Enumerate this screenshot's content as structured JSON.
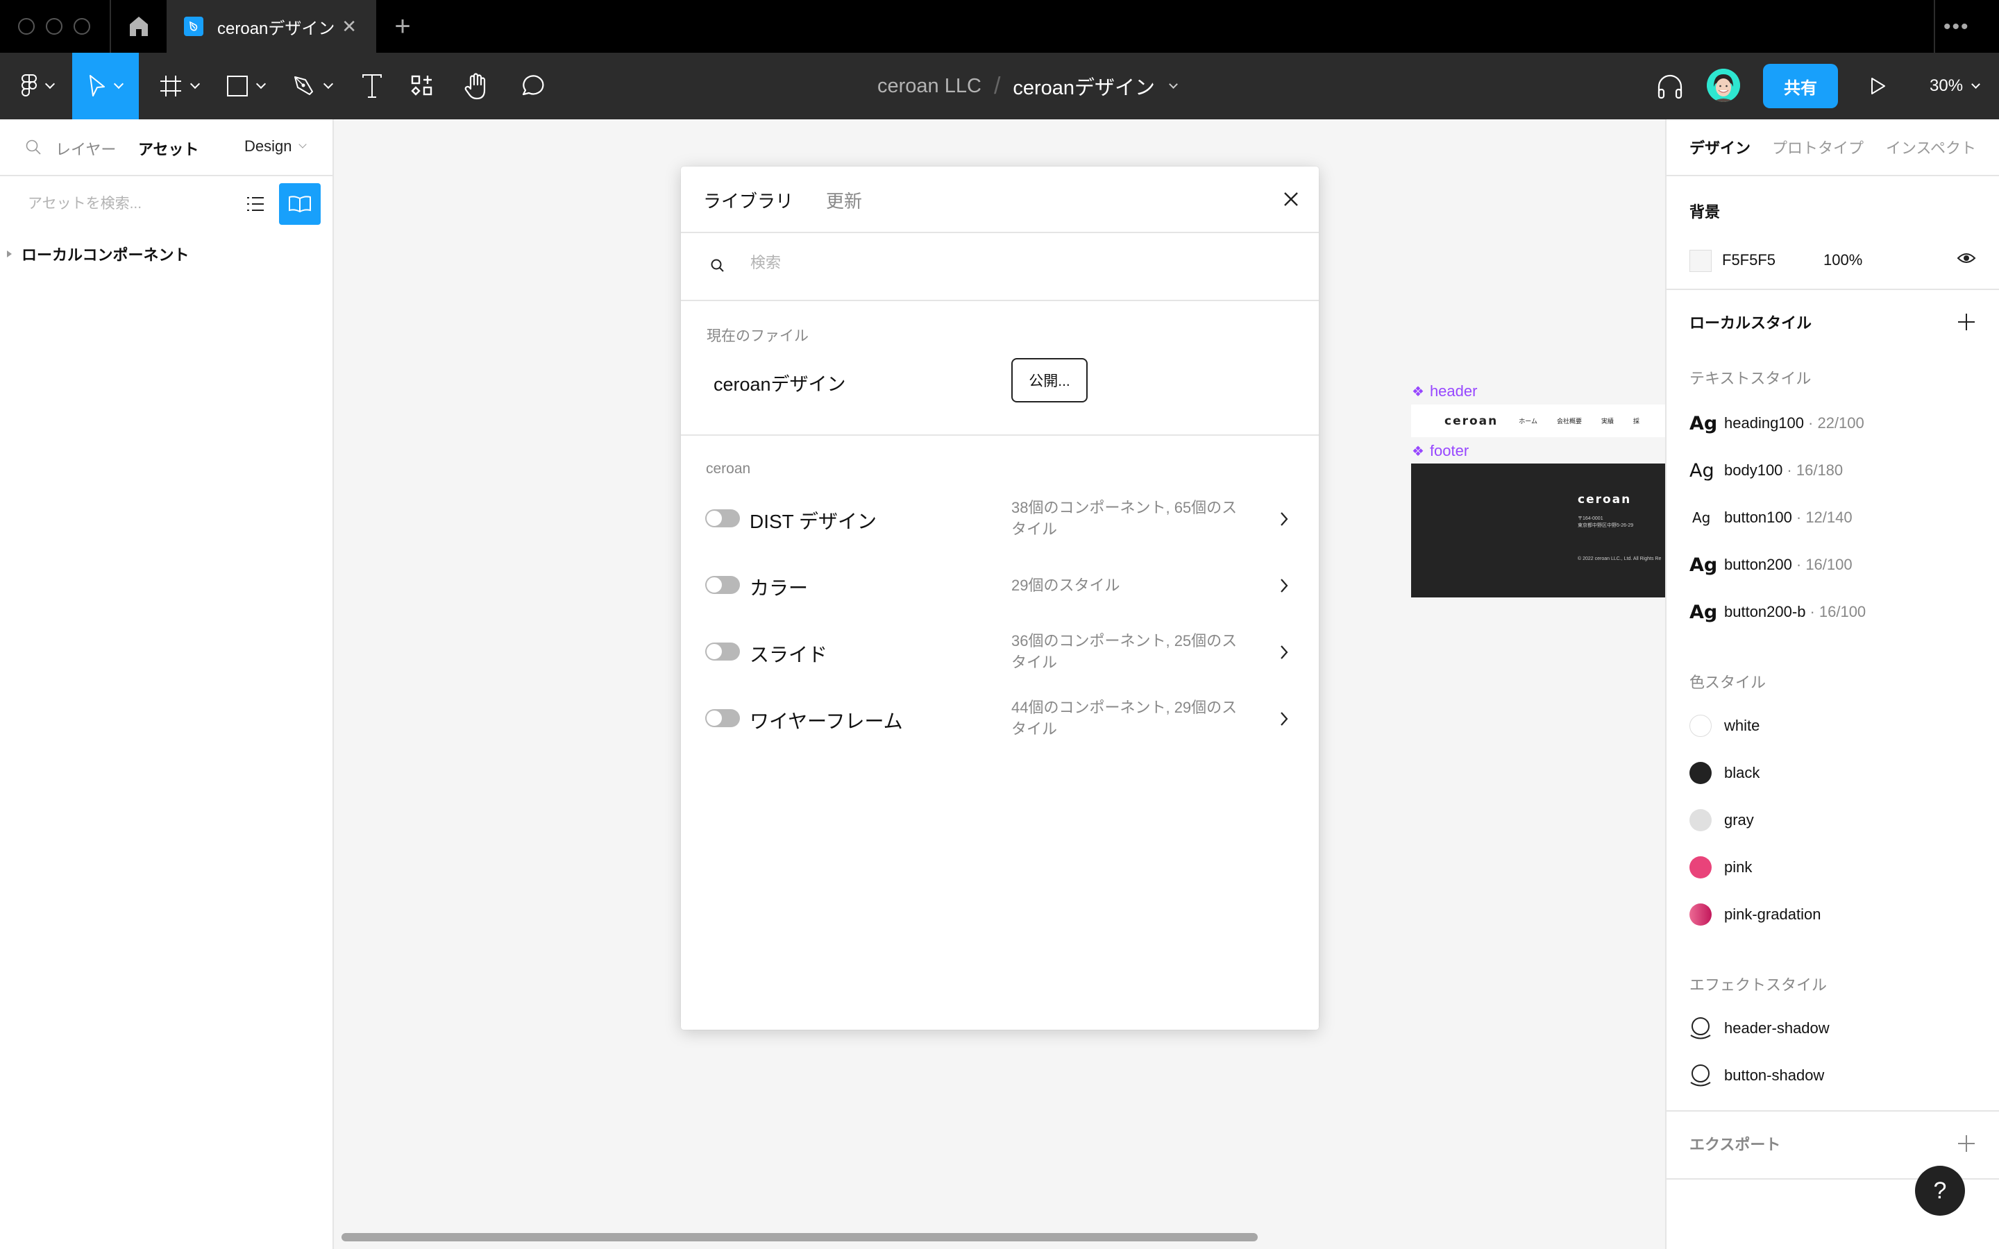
{
  "tabbar": {
    "file_tab_title": "ceroanデザイン",
    "close_glyph": "✕",
    "new_tab_glyph": "+",
    "more_glyph": "•••"
  },
  "toolbar": {
    "tools": [
      "main-menu",
      "move",
      "frame",
      "shape",
      "pen",
      "text",
      "resources",
      "hand",
      "comment"
    ],
    "active_tool": "move",
    "breadcrumb": {
      "team": "ceroan LLC",
      "separator": "/",
      "file": "ceroanデザイン"
    },
    "share_label": "共有",
    "zoom_level": "30%",
    "accent_color": "#18A0FB"
  },
  "left_panel": {
    "tabs": [
      {
        "label": "レイヤー",
        "active": false
      },
      {
        "label": "アセット",
        "active": true
      }
    ],
    "page_selector": "Design",
    "search_placeholder": "アセットを検索...",
    "section": "ローカルコンポーネント"
  },
  "canvas": {
    "components": [
      {
        "label": "header",
        "nav": [
          "ホーム",
          "会社概要",
          "実績",
          "採"
        ],
        "logo": "ceroan"
      },
      {
        "label": "footer",
        "logo": "ceroan",
        "postal": "〒164-0001",
        "address": "東京都中野区中野5-26-29",
        "copyright": "© 2022 ceroan LLC., Ltd. All Rights Re"
      }
    ]
  },
  "dialog": {
    "tabs": [
      {
        "label": "ライブラリ",
        "active": true
      },
      {
        "label": "更新",
        "active": false
      }
    ],
    "search_placeholder": "検索",
    "search_value": "",
    "current_file": {
      "label": "現在のファイル",
      "name": "ceroanデザイン",
      "publish_label": "公開..."
    },
    "team_section": {
      "label": "ceroan",
      "libraries": [
        {
          "name": "DIST デザイン",
          "meta": "38個のコンポーネント, 65個のスタイル",
          "enabled": false
        },
        {
          "name": "カラー",
          "meta": "29個のスタイル",
          "enabled": false
        },
        {
          "name": "スライド",
          "meta": "36個のコンポーネント, 25個のスタイル",
          "enabled": false
        },
        {
          "name": "ワイヤーフレーム",
          "meta": "44個のコンポーネント, 29個のスタイル",
          "enabled": false
        }
      ]
    }
  },
  "right_panel": {
    "tabs": [
      {
        "label": "デザイン",
        "active": true
      },
      {
        "label": "プロトタイプ",
        "active": false
      },
      {
        "label": "インスペクト",
        "active": false
      }
    ],
    "background": {
      "title": "背景",
      "hex": "F5F5F5",
      "opacity": "100%"
    },
    "local_styles": {
      "title": "ローカルスタイル",
      "text_styles_label": "テキストスタイル",
      "text_styles": [
        {
          "sample": "Ag",
          "name": "heading100",
          "meta": "· 22/100"
        },
        {
          "sample": "Ag",
          "name": "body100",
          "meta": "· 16/180"
        },
        {
          "sample": "Ag",
          "name": "button100",
          "meta": "· 12/140"
        },
        {
          "sample": "Ag",
          "name": "button200",
          "meta": "· 16/100"
        },
        {
          "sample": "Ag",
          "name": "button200-b",
          "meta": "· 16/100"
        }
      ],
      "color_styles_label": "色スタイル",
      "color_styles": [
        {
          "name": "white",
          "color": "#FFFFFF"
        },
        {
          "name": "black",
          "color": "#222222"
        },
        {
          "name": "gray",
          "color": "#E0E0E0"
        },
        {
          "name": "pink",
          "color": "#E9437A"
        },
        {
          "name": "pink-gradation",
          "color": "#C2185B"
        }
      ],
      "effect_styles_label": "エフェクトスタイル",
      "effect_styles": [
        {
          "name": "header-shadow"
        },
        {
          "name": "button-shadow"
        }
      ]
    },
    "export_title": "エクスポート",
    "help_label": "?"
  }
}
